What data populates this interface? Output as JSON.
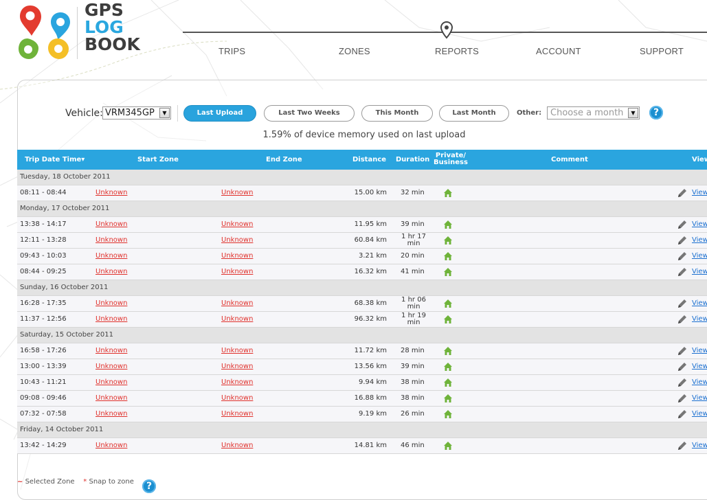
{
  "logo": {
    "line1": "GPS",
    "line2": "LOG",
    "line3": "BOOK"
  },
  "nav": [
    {
      "label": "TRIPS"
    },
    {
      "label": "ZONES"
    },
    {
      "label": "REPORTS"
    },
    {
      "label": "ACCOUNT"
    },
    {
      "label": "SUPPORT"
    }
  ],
  "filters": {
    "vehicle_label": "Vehicle:",
    "vehicle_value": "VRM345GP",
    "buttons": [
      {
        "label": "Last Upload",
        "active": true
      },
      {
        "label": "Last Two Weeks",
        "active": false
      },
      {
        "label": "This Month",
        "active": false
      },
      {
        "label": "Last Month",
        "active": false
      }
    ],
    "other_label": "Other:",
    "month_placeholder": "Choose a month",
    "help": "?"
  },
  "memory_note": "1.59% of device memory used on last upload",
  "table": {
    "headers": {
      "trip_date_time": "Trip Date Time▾",
      "start_zone": "Start Zone",
      "end_zone": "End Zone",
      "distance": "Distance",
      "duration": "Duration",
      "private_business_1": "Private/",
      "private_business_2": "Business",
      "comment": "Comment",
      "view": "View"
    },
    "days": [
      {
        "label": "Tuesday, 18 October 2011",
        "trips": [
          {
            "time": "08:11 - 08:44",
            "start": "Unknown",
            "end": "Unknown",
            "distance": "15.00 km",
            "duration": "32 min",
            "view": "View"
          }
        ]
      },
      {
        "label": "Monday, 17 October 2011",
        "trips": [
          {
            "time": "13:38 - 14:17",
            "start": "Unknown",
            "end": "Unknown",
            "distance": "11.95 km",
            "duration": "39 min",
            "view": "View"
          },
          {
            "time": "12:11 - 13:28",
            "start": "Unknown",
            "end": "Unknown",
            "distance": "60.84 km",
            "duration": "1 hr 17 min",
            "dur_a": "1 hr 17",
            "dur_b": "min",
            "view": "View"
          },
          {
            "time": "09:43 - 10:03",
            "start": "Unknown",
            "end": "Unknown",
            "distance": "3.21 km",
            "duration": "20 min",
            "view": "View"
          },
          {
            "time": "08:44 - 09:25",
            "start": "Unknown",
            "end": "Unknown",
            "distance": "16.32 km",
            "duration": "41 min",
            "view": "View"
          }
        ]
      },
      {
        "label": "Sunday, 16 October 2011",
        "trips": [
          {
            "time": "16:28 - 17:35",
            "start": "Unknown",
            "end": "Unknown",
            "distance": "68.38 km",
            "duration": "1 hr 06 min",
            "dur_a": "1 hr 06",
            "dur_b": "min",
            "view": "View"
          },
          {
            "time": "11:37 - 12:56",
            "start": "Unknown",
            "end": "Unknown",
            "distance": "96.32 km",
            "duration": "1 hr 19 min",
            "dur_a": "1 hr 19",
            "dur_b": "min",
            "view": "View"
          }
        ]
      },
      {
        "label": "Saturday, 15 October 2011",
        "trips": [
          {
            "time": "16:58 - 17:26",
            "start": "Unknown",
            "end": "Unknown",
            "distance": "11.72 km",
            "duration": "28 min",
            "view": "View"
          },
          {
            "time": "13:00 - 13:39",
            "start": "Unknown",
            "end": "Unknown",
            "distance": "13.56 km",
            "duration": "39 min",
            "view": "View"
          },
          {
            "time": "10:43 - 11:21",
            "start": "Unknown",
            "end": "Unknown",
            "distance": "9.94 km",
            "duration": "38 min",
            "view": "View"
          },
          {
            "time": "09:08 - 09:46",
            "start": "Unknown",
            "end": "Unknown",
            "distance": "16.88 km",
            "duration": "38 min",
            "view": "View"
          },
          {
            "time": "07:32 - 07:58",
            "start": "Unknown",
            "end": "Unknown",
            "distance": "9.19 km",
            "duration": "26 min",
            "view": "View"
          }
        ]
      },
      {
        "label": "Friday, 14 October 2011",
        "trips": [
          {
            "time": "13:42 - 14:29",
            "start": "Unknown",
            "end": "Unknown",
            "distance": "14.81 km",
            "duration": "46 min",
            "view": "View"
          }
        ]
      }
    ]
  },
  "legend": {
    "tilde": "~",
    "selected_zone": "Selected Zone",
    "star": "*",
    "snap_to_zone": "Snap to zone",
    "help": "?"
  },
  "colors": {
    "accent_blue": "#2aa5df",
    "link_red": "#e0302b",
    "link_blue": "#1a6fd0",
    "house_green": "#6fb33a"
  }
}
